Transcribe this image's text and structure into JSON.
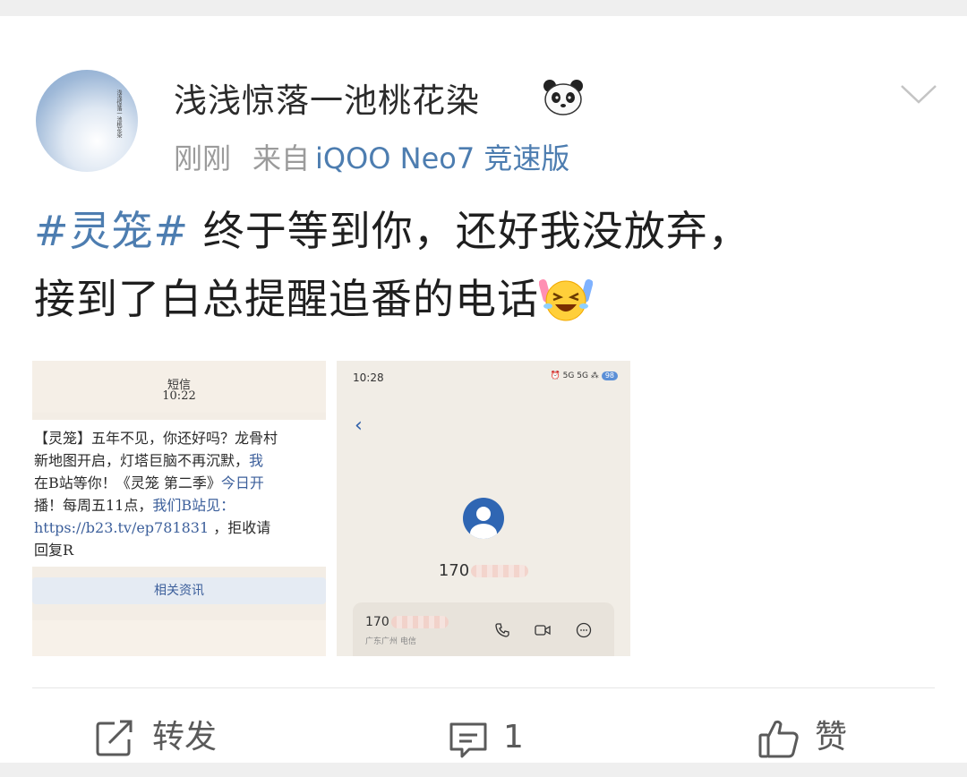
{
  "post": {
    "username": "浅浅惊落一池桃花染",
    "time": "刚刚",
    "from_label": "来自",
    "device": "iQOO Neo7 竞速版",
    "hashtag": "#灵笼#",
    "text_line1": " 终于等到你，还好我没放弃，",
    "text_line2": "接到了白总提醒追番的电话"
  },
  "avatar_text": "浅浅惊落一池桃花染",
  "screenshot_sms": {
    "title": "短信",
    "time": "10:22",
    "lines": [
      {
        "pre": "【灵笼】五年不见，你还好吗？龙骨村",
        "link": ""
      },
      {
        "pre": "新地图开启，灯塔巨脑不再沉默，",
        "link": "我"
      },
      {
        "pre": "在B站等你！《灵笼 第二季》",
        "link": "今日开"
      },
      {
        "pre": "播！每周五11点，",
        "link": "我们B站见："
      },
      {
        "pre": "",
        "link": "https://b23.tv/ep781831",
        "post": " ，拒收请"
      },
      {
        "pre": "回复R",
        "link": ""
      }
    ],
    "button_label": "相关资讯"
  },
  "screenshot_call": {
    "status_time": "10:28",
    "status_icons": "⏰ 5G 5G ⁂",
    "battery": "98",
    "number": "170",
    "card_number": "170",
    "card_location": "广东广州  电信"
  },
  "actions": {
    "repost": "转发",
    "comment_count": "1",
    "like": "赞"
  },
  "colors": {
    "accent": "#4d7db0",
    "text": "#1f1f1f",
    "muted": "#9b9b9b",
    "background": "#efefef"
  }
}
